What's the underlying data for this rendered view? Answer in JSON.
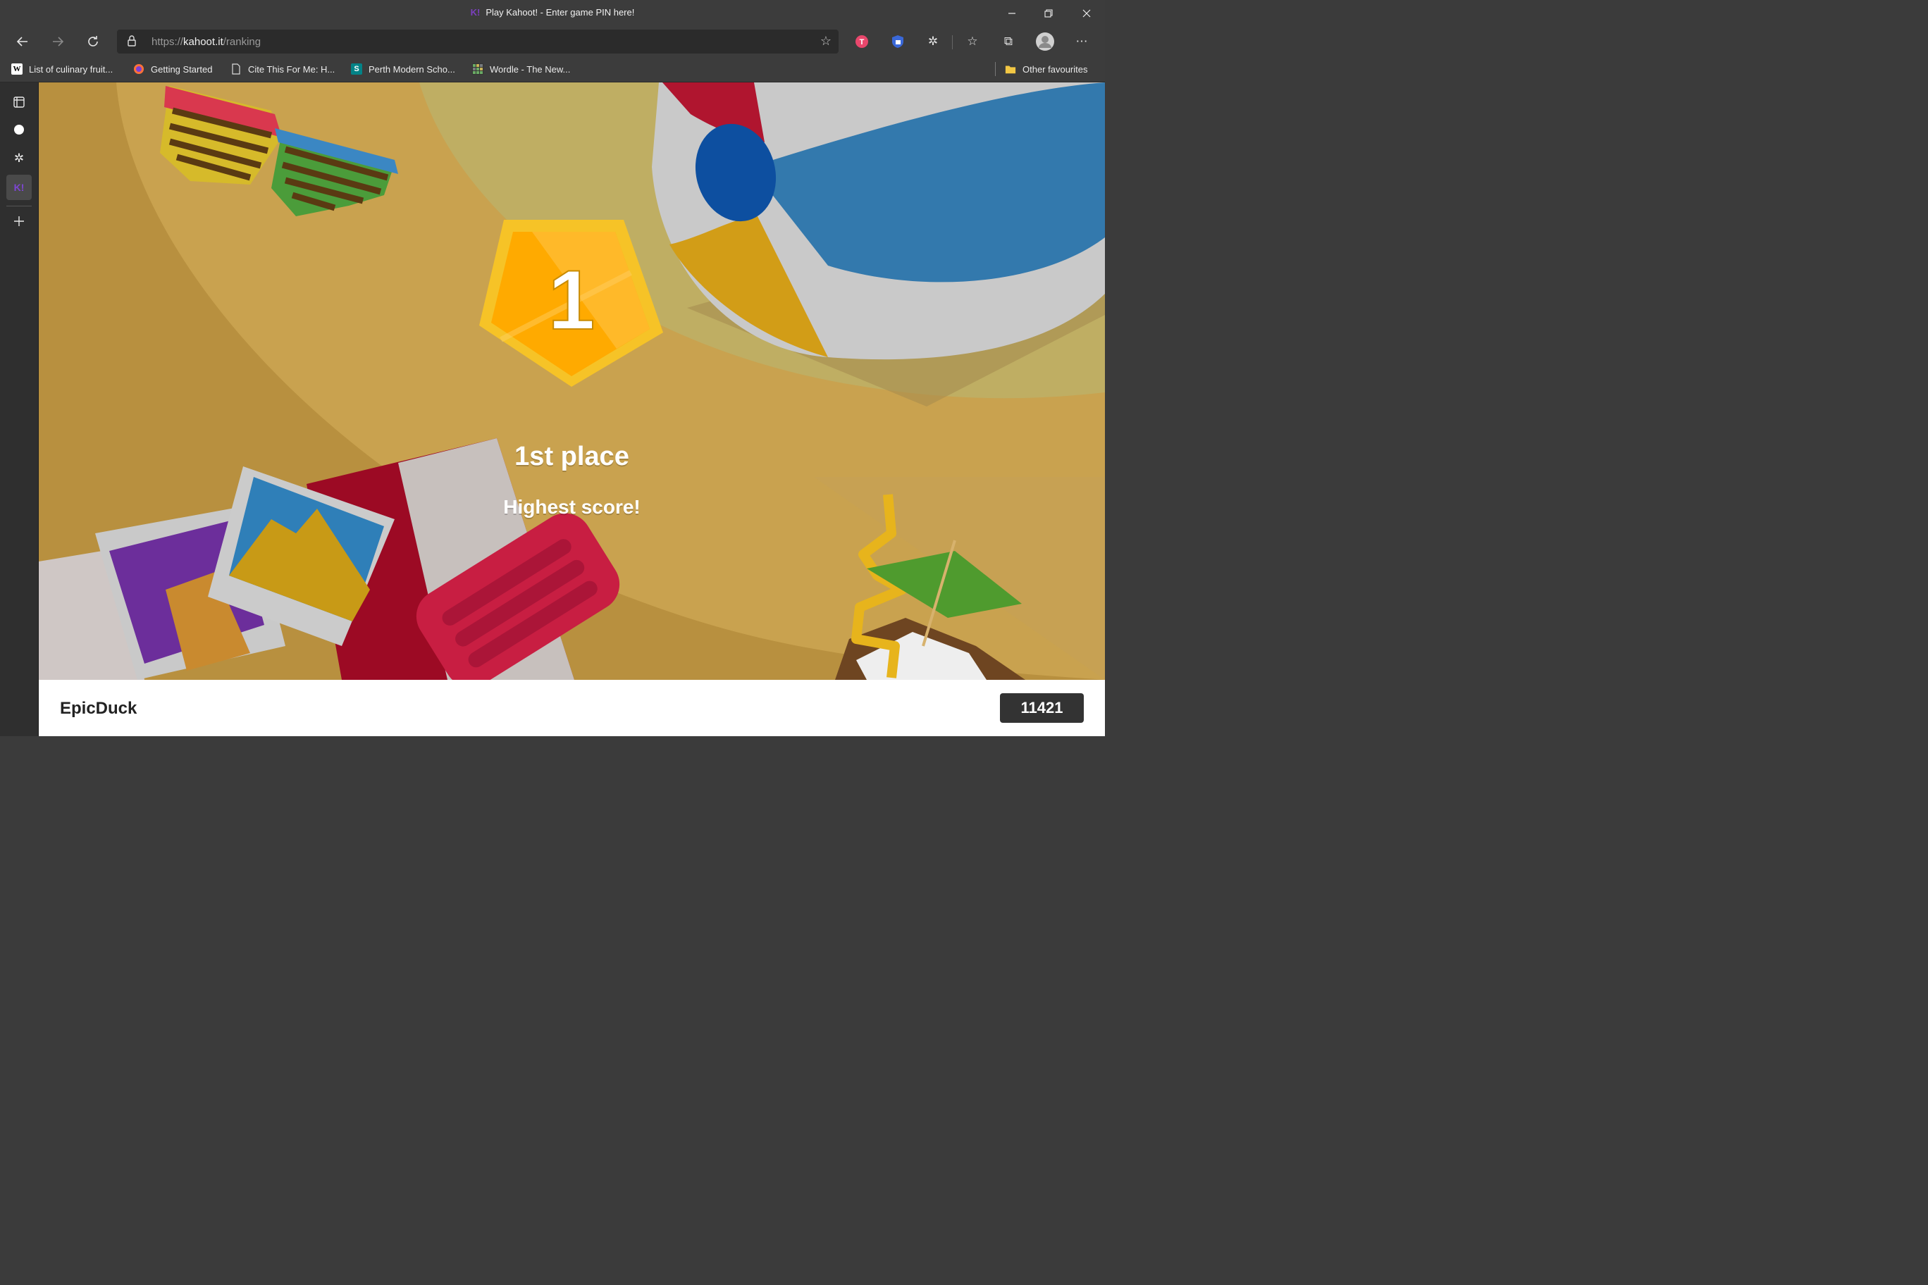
{
  "window": {
    "title": "Play Kahoot! - Enter game PIN here!",
    "logo": "K!",
    "minimize_icon": "minimize-icon",
    "maximize_icon": "restore-icon",
    "close_icon": "close-icon"
  },
  "toolbar": {
    "url_scheme": "https://",
    "url_host": "kahoot.it",
    "url_path": "/ranking"
  },
  "bookmarks": {
    "items": [
      {
        "label": "List of culinary fruit...",
        "icon": "wikipedia-icon"
      },
      {
        "label": "Getting Started",
        "icon": "firefox-icon"
      },
      {
        "label": "Cite This For Me: H...",
        "icon": "page-icon"
      },
      {
        "label": "Perth Modern Scho...",
        "icon": "sharepoint-icon"
      },
      {
        "label": "Wordle - The New...",
        "icon": "wordle-icon"
      }
    ],
    "other": "Other favourites"
  },
  "game": {
    "rank_number": "1",
    "place_label": "1st place",
    "subtitle": "Highest score!",
    "nickname": "EpicDuck",
    "score": "11421"
  },
  "colors": {
    "sand": "#c29a4c",
    "medal_gold": "#ffb400",
    "ball_blue": "#3379ad",
    "ball_red": "#b0152f",
    "towel_red": "#9c0a24",
    "score_bg": "#333333"
  }
}
